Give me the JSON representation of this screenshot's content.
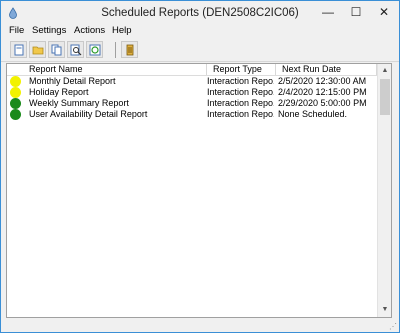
{
  "window": {
    "title": "Scheduled Reports (DEN2508C2IC06)",
    "icon": "app-drop-icon",
    "minimize_glyph": "—",
    "maximize_glyph": "☐",
    "close_glyph": "✕"
  },
  "menu": [
    "File",
    "Settings",
    "Actions",
    "Help"
  ],
  "toolbar": {
    "buttons": [
      "new-report-icon",
      "open-folder-icon",
      "copy-icon",
      "find-icon",
      "refresh-icon",
      "column-config-icon"
    ]
  },
  "list": {
    "columns": [
      "Report Name",
      "Report Type",
      "Next Run Date"
    ],
    "rows": [
      {
        "status": "yellow",
        "name": "Monthly Detail Report",
        "type": "Interaction Repo...",
        "next_run": "2/5/2020 12:30:00 AM"
      },
      {
        "status": "yellow",
        "name": "Holiday Report",
        "type": "Interaction Repo...",
        "next_run": "2/4/2020 12:15:00 PM"
      },
      {
        "status": "green",
        "name": "Weekly Summary Report",
        "type": "Interaction Repo...",
        "next_run": "2/29/2020 5:00:00 PM"
      },
      {
        "status": "green",
        "name": "User Availability Detail Report",
        "type": "Interaction Repo...",
        "next_run": "None Scheduled."
      }
    ]
  },
  "colors": {
    "yellow": "#f2f200",
    "green": "#1a8a1a",
    "window_border": "#3a8fd6"
  }
}
